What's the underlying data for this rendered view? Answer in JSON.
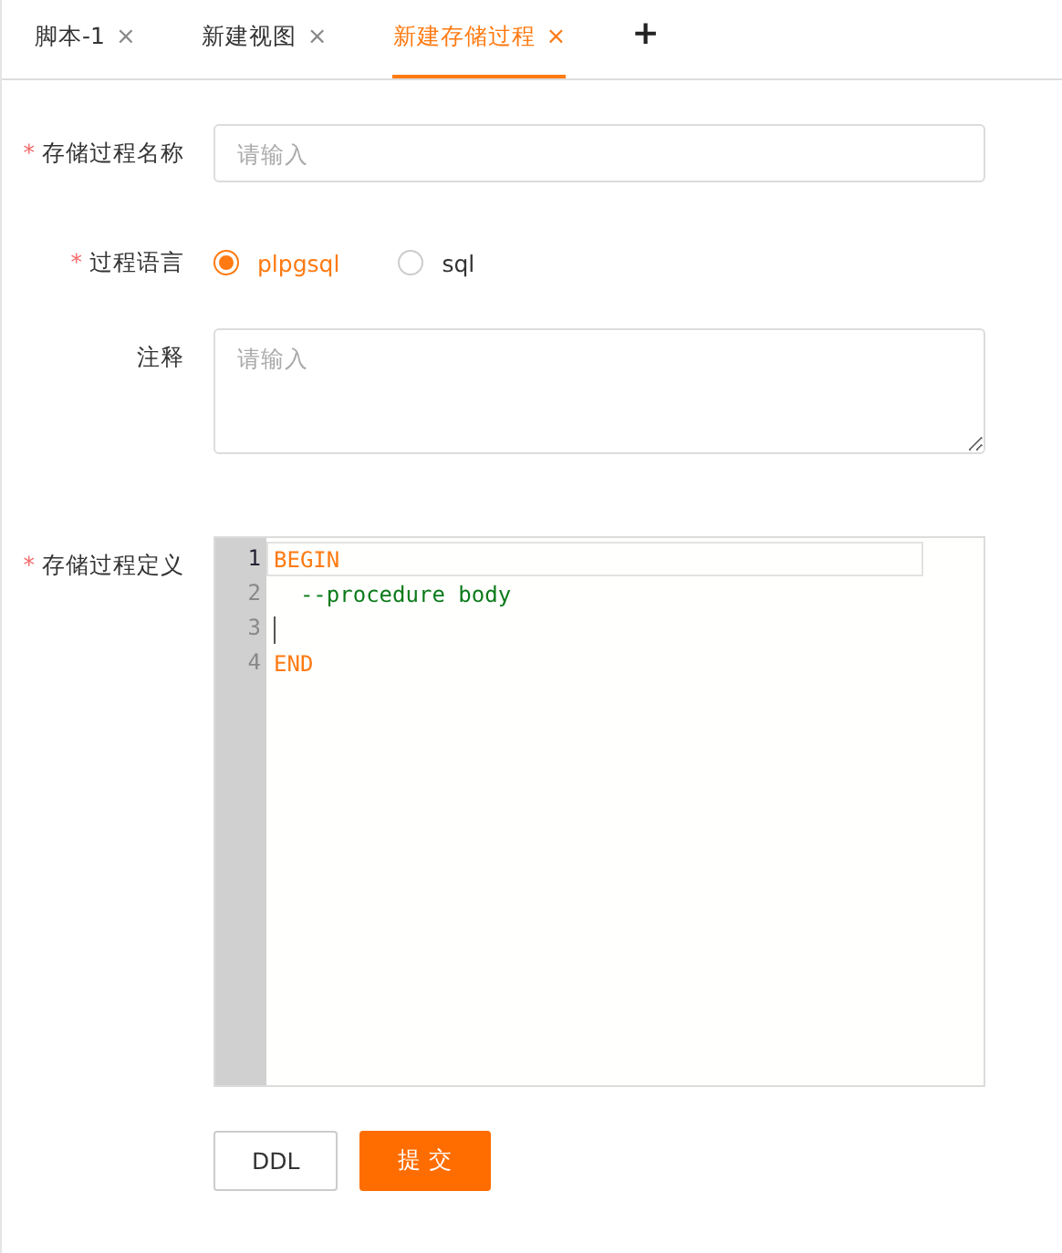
{
  "tabs": [
    {
      "label": "脚本-1",
      "close": "×",
      "selected": false
    },
    {
      "label": "新建视图",
      "close": "×",
      "selected": false
    },
    {
      "label": "新建存储过程",
      "close": "×",
      "selected": true
    }
  ],
  "add_tab": "+",
  "required_mark": "*",
  "form": {
    "name": {
      "label": "存储过程名称",
      "required": true,
      "placeholder": "请输入"
    },
    "language": {
      "label": "过程语言",
      "required": true,
      "options": [
        {
          "label": "plpgsql",
          "selected": true
        },
        {
          "label": "sql",
          "selected": false
        }
      ]
    },
    "comment": {
      "label": "注释",
      "required": false,
      "placeholder": "请输入"
    },
    "definition": {
      "label": "存储过程定义",
      "required": true,
      "lines": [
        {
          "number": "1",
          "text": "BEGIN",
          "kind": "keyword",
          "selected": true
        },
        {
          "number": "2",
          "text": "  --procedure body",
          "kind": "comment",
          "selected": false
        },
        {
          "number": "3",
          "kind": "blank",
          "selected": false
        },
        {
          "number": "4",
          "text": "END",
          "kind": "keyword",
          "selected": false
        }
      ]
    }
  },
  "buttons": [
    {
      "label": "DDL",
      "kind": "default"
    },
    {
      "label": "提交",
      "kind": "primary"
    }
  ]
}
